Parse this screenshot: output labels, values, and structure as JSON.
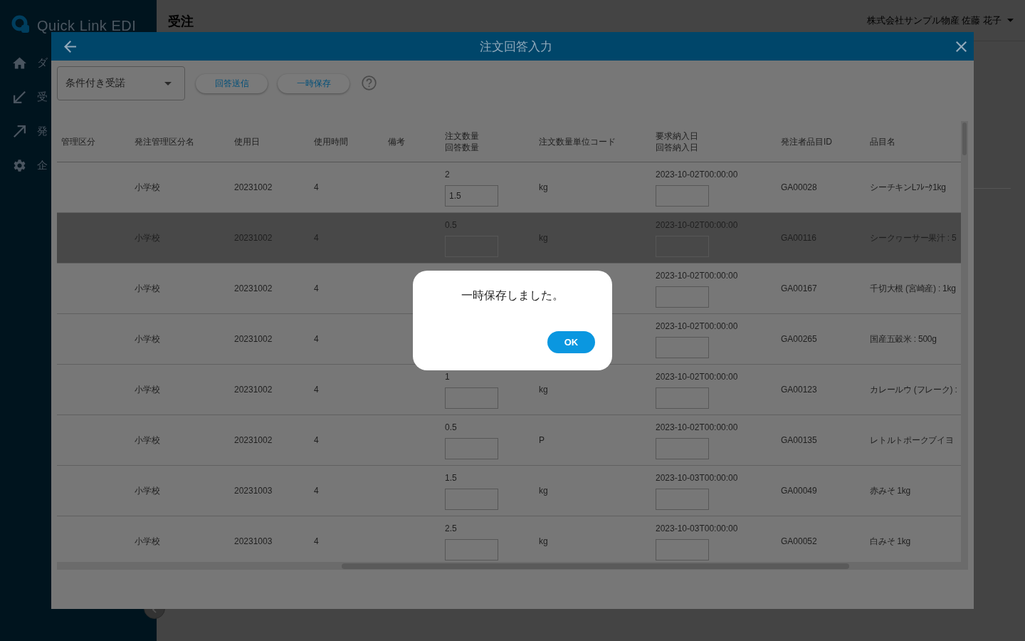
{
  "app": {
    "logo": "Quick Link EDI",
    "nav": [
      {
        "kind": "home",
        "label": "ダ"
      },
      {
        "kind": "inbound",
        "label": "受"
      },
      {
        "kind": "outbound",
        "label": "発"
      },
      {
        "kind": "settings",
        "label": "企"
      }
    ],
    "page_title": "受注",
    "user": "株式会社サンプル物産 佐藤 花子"
  },
  "modal": {
    "title": "注文回答入力",
    "response_type": "条件付き受諾",
    "buttons": [
      "回答送信",
      "一時保存"
    ],
    "table": {
      "columns": [
        [
          "管理区分"
        ],
        [
          "発注管理区分名"
        ],
        [
          "使用日"
        ],
        [
          "使用時間"
        ],
        [
          "備考"
        ],
        [
          "注文数量",
          "回答数量"
        ],
        [
          "注文数量単位コード"
        ],
        [
          "要求納入日",
          "回答納入日"
        ],
        [
          "発注者品目ID"
        ],
        [
          "品目名"
        ]
      ],
      "rows": [
        {
          "selected": false,
          "category_name": "小学校",
          "use_date": "20231002",
          "use_time": "4",
          "order_qty": "2",
          "answer_qty": "1.5",
          "unit": "kg",
          "requested_date": "2023-10-02T00:00:00",
          "item_id": "GA00028",
          "item_name": "シーチキンLﾌﾚｰｸ1kg"
        },
        {
          "selected": true,
          "category_name": "小学校",
          "use_date": "20231002",
          "use_time": "4",
          "order_qty": "0.5",
          "unit": "kg",
          "requested_date": "2023-10-02T00:00:00",
          "item_id": "GA00116",
          "item_name": "シークヮーサー果汁 : 5"
        },
        {
          "selected": false,
          "category_name": "小学校",
          "use_date": "20231002",
          "use_time": "4",
          "requested_date": "2023-10-02T00:00:00",
          "item_id": "GA00167",
          "item_name": "千切大根 (宮崎産) : 1kg"
        },
        {
          "selected": false,
          "category_name": "小学校",
          "use_date": "20231002",
          "use_time": "4",
          "requested_date": "2023-10-02T00:00:00",
          "item_id": "GA00265",
          "item_name": "国産五穀米 : 500g"
        },
        {
          "selected": false,
          "category_name": "小学校",
          "use_date": "20231002",
          "use_time": "4",
          "order_qty": "1",
          "unit": "kg",
          "requested_date": "2023-10-02T00:00:00",
          "item_id": "GA00123",
          "item_name": "カレールウ (フレーク) :"
        },
        {
          "selected": false,
          "category_name": "小学校",
          "use_date": "20231002",
          "use_time": "4",
          "order_qty": "0.5",
          "unit": "P",
          "requested_date": "2023-10-02T00:00:00",
          "item_id": "GA00135",
          "item_name": "レトルトポークブイヨ"
        },
        {
          "selected": false,
          "category_name": "小学校",
          "use_date": "20231003",
          "use_time": "4",
          "order_qty": "1.5",
          "unit": "kg",
          "requested_date": "2023-10-03T00:00:00",
          "item_id": "GA00049",
          "item_name": "赤みそ 1kg"
        },
        {
          "selected": false,
          "category_name": "小学校",
          "use_date": "20231003",
          "use_time": "4",
          "order_qty": "2.5",
          "unit": "kg",
          "requested_date": "2023-10-03T00:00:00",
          "item_id": "GA00052",
          "item_name": "白みそ 1kg"
        }
      ]
    }
  },
  "dialog": {
    "message": "一時保存しました。",
    "button": "OK"
  }
}
